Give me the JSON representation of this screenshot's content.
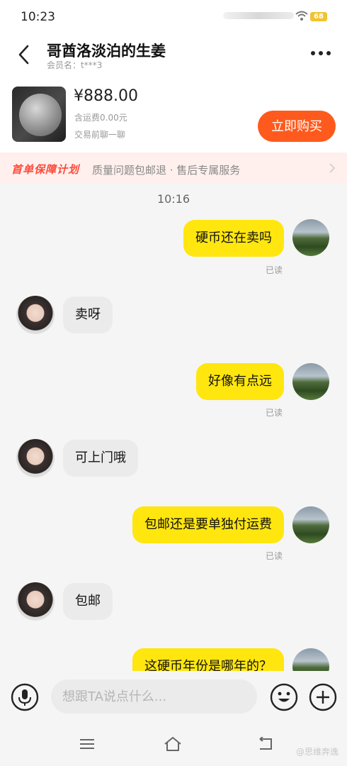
{
  "status": {
    "time": "10:23",
    "battery": "68"
  },
  "header": {
    "title": "哥酋洛淡泊的生姜",
    "member": "会员名：t***3"
  },
  "product": {
    "price": "¥888.00",
    "shipping": "含运费0.00元",
    "chat_hint": "交易前聊一聊",
    "buy_label": "立即购买"
  },
  "protection": {
    "tag": "首单保障计划",
    "text": "质量问题包邮退 · 售后专属服务"
  },
  "chat": {
    "timestamp": "10:16",
    "messages": [
      {
        "from": "me",
        "text": "硬币还在卖吗",
        "status": "已读"
      },
      {
        "from": "other",
        "text": "卖呀"
      },
      {
        "from": "me",
        "text": "好像有点远",
        "status": "已读"
      },
      {
        "from": "other",
        "text": "可上门哦"
      },
      {
        "from": "me",
        "text": "包邮还是要单独付运费",
        "status": "已读"
      },
      {
        "from": "other",
        "text": "包邮"
      },
      {
        "from": "me",
        "text": "这硬币年份是哪年的？"
      }
    ]
  },
  "input": {
    "placeholder": "想跟TA说点什么..."
  },
  "watermark": "@思维奔逸",
  "colors": {
    "accent_yellow": "#ffe60f",
    "buy_orange": "#fe5a1d",
    "protect_red": "#fe4a3a"
  },
  "icons": [
    "back-arrow-icon",
    "more-icon",
    "mic-icon",
    "emoji-icon",
    "plus-icon",
    "menu-icon",
    "home-icon",
    "back-icon",
    "wifi-icon",
    "chevron-right-icon"
  ]
}
